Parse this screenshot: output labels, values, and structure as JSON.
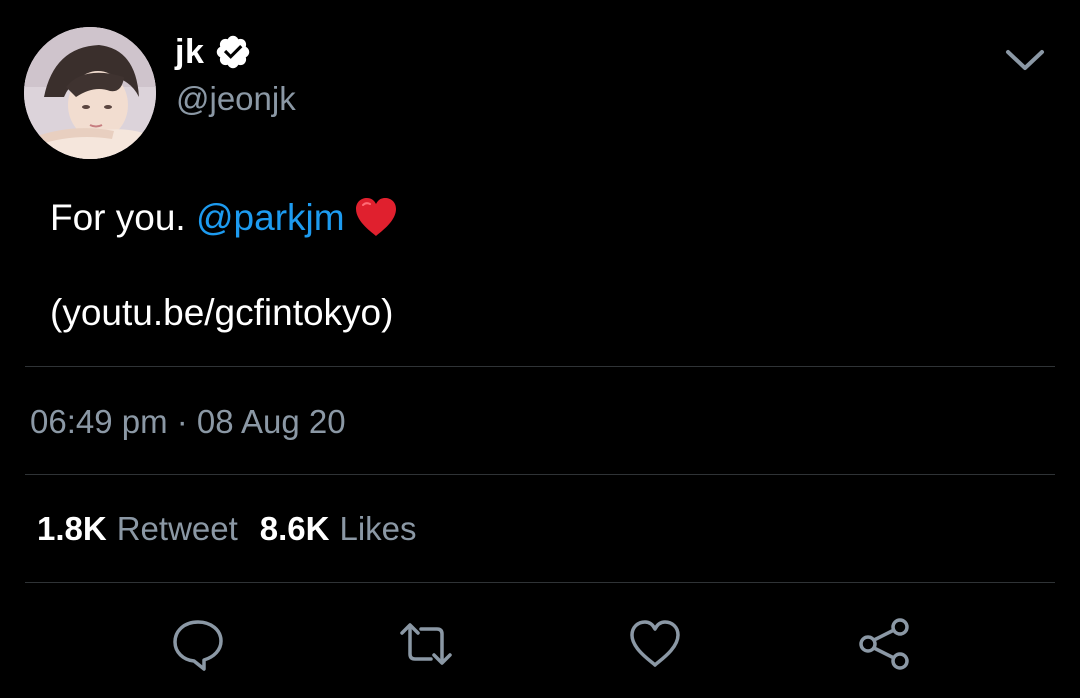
{
  "user": {
    "display_name": "jk",
    "handle": "@jeonjk",
    "verified": true
  },
  "tweet": {
    "text_prefix": "For you. ",
    "mention": "@parkjm",
    "emoji": "red-heart",
    "link_text": "(youtu.be/gcfintokyo)",
    "timestamp": "06:49 pm · 08 Aug 20"
  },
  "stats": {
    "retweet_count": "1.8K",
    "retweet_label": "Retweet",
    "like_count": "8.6K",
    "like_label": "Likes"
  },
  "actions": [
    "reply-icon",
    "retweet-icon",
    "like-icon",
    "share-icon"
  ],
  "colors": {
    "background": "#000000",
    "text": "#ffffff",
    "secondary_text": "#8b98a5",
    "accent": "#1d9bf0",
    "divider": "#2f3336",
    "heart": "#e0202e"
  }
}
